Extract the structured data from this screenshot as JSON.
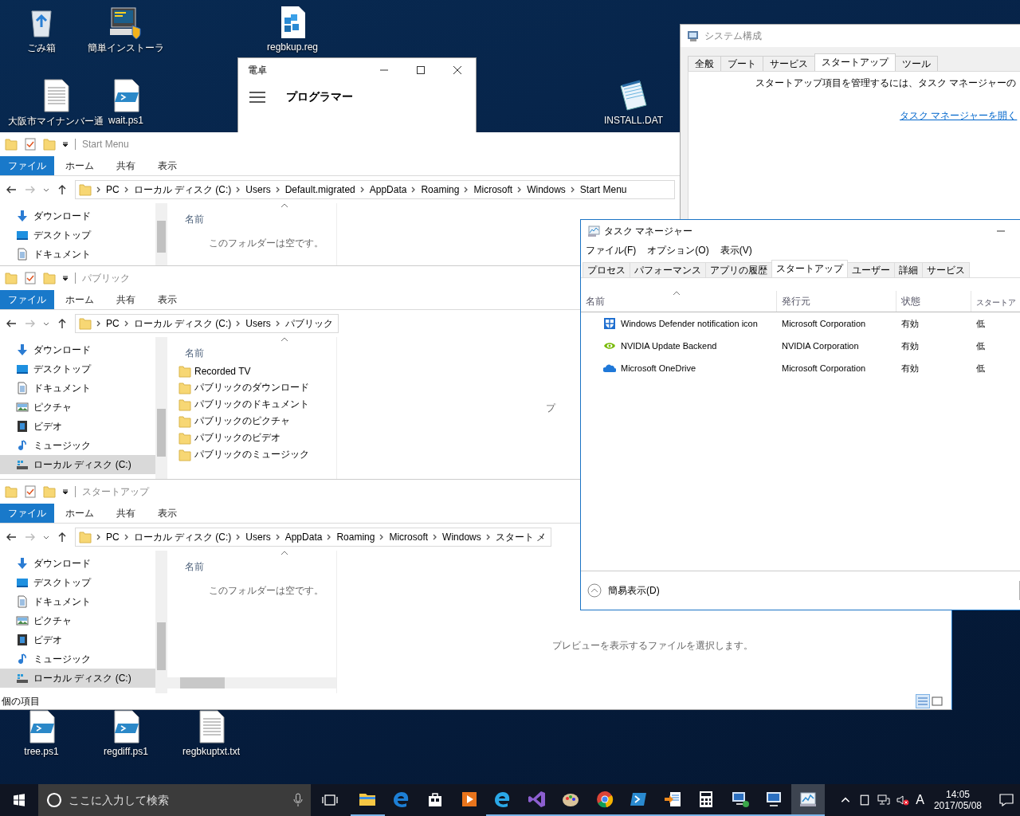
{
  "desktop_icons": [
    {
      "label": "ごみ箱",
      "kind": "recycle"
    },
    {
      "label": "簡単インストーラ",
      "kind": "installer"
    },
    {
      "label": "regbkup.reg",
      "kind": "registry"
    },
    {
      "label": "大阪市マイナンバー通",
      "kind": "text"
    },
    {
      "label": "wait.ps1",
      "kind": "script"
    },
    {
      "label": "INSTALL.DAT",
      "kind": "notepad"
    },
    {
      "label": "tree.ps1",
      "kind": "script"
    },
    {
      "label": "regdiff.ps1",
      "kind": "script"
    },
    {
      "label": "regbkuptxt.txt",
      "kind": "text"
    }
  ],
  "calculator": {
    "title": "電卓",
    "mode": "プログラマー"
  },
  "system_config": {
    "title": "システム構成",
    "tabs": [
      {
        "label": "全般",
        "selected": false
      },
      {
        "label": "ブート",
        "selected": false
      },
      {
        "label": "サービス",
        "selected": false
      },
      {
        "label": "スタートアップ",
        "selected": true
      },
      {
        "label": "ツール",
        "selected": false
      }
    ],
    "message": "スタートアップ項目を管理するには、タスク マネージャーの",
    "link": "タスク マネージャーを開く"
  },
  "explorers": [
    {
      "title": "Start Menu",
      "ribbon_tabs": [
        {
          "label": "ファイル",
          "selected": true
        },
        {
          "label": "ホーム",
          "selected": false
        },
        {
          "label": "共有",
          "selected": false
        },
        {
          "label": "表示",
          "selected": false
        }
      ],
      "path": [
        "PC",
        "ローカル ディスク (C:)",
        "Users",
        "Default.migrated",
        "AppData",
        "Roaming",
        "Microsoft",
        "Windows",
        "Start Menu"
      ],
      "nav": [
        {
          "label": "ダウンロード",
          "kind": "download",
          "selected": false
        },
        {
          "label": "デスクトップ",
          "kind": "desktop",
          "selected": false
        },
        {
          "label": "ドキュメント",
          "kind": "documents",
          "selected": false
        }
      ],
      "column": "名前",
      "empty_text": "このフォルダーは空です。"
    },
    {
      "title": "パブリック",
      "ribbon_tabs": [
        {
          "label": "ファイル",
          "selected": true
        },
        {
          "label": "ホーム",
          "selected": false
        },
        {
          "label": "共有",
          "selected": false
        },
        {
          "label": "表示",
          "selected": false
        }
      ],
      "path": [
        "PC",
        "ローカル ディスク (C:)",
        "Users",
        "パブリック"
      ],
      "nav": [
        {
          "label": "ダウンロード",
          "kind": "download",
          "selected": false
        },
        {
          "label": "デスクトップ",
          "kind": "desktop",
          "selected": false
        },
        {
          "label": "ドキュメント",
          "kind": "documents",
          "selected": false
        },
        {
          "label": "ピクチャ",
          "kind": "pictures",
          "selected": false
        },
        {
          "label": "ビデオ",
          "kind": "videos",
          "selected": false
        },
        {
          "label": "ミュージック",
          "kind": "music",
          "selected": false
        },
        {
          "label": "ローカル ディスク (C:)",
          "kind": "drive",
          "selected": true
        }
      ],
      "column": "名前",
      "files": [
        "Recorded TV",
        "パブリックのダウンロード",
        "パブリックのドキュメント",
        "パブリックのピクチャ",
        "パブリックのビデオ",
        "パブリックのミュージック"
      ],
      "preview_text": "プ"
    },
    {
      "title": "スタートアップ",
      "ribbon_tabs": [
        {
          "label": "ファイル",
          "selected": true
        },
        {
          "label": "ホーム",
          "selected": false
        },
        {
          "label": "共有",
          "selected": false
        },
        {
          "label": "表示",
          "selected": false
        }
      ],
      "path": [
        "PC",
        "ローカル ディスク (C:)",
        "Users",
        "AppData",
        "Roaming",
        "Microsoft",
        "Windows",
        "スタート メ"
      ],
      "nav": [
        {
          "label": "ダウンロード",
          "kind": "download",
          "selected": false
        },
        {
          "label": "デスクトップ",
          "kind": "desktop",
          "selected": false
        },
        {
          "label": "ドキュメント",
          "kind": "documents",
          "selected": false
        },
        {
          "label": "ピクチャ",
          "kind": "pictures",
          "selected": false
        },
        {
          "label": "ビデオ",
          "kind": "videos",
          "selected": false
        },
        {
          "label": "ミュージック",
          "kind": "music",
          "selected": false
        },
        {
          "label": "ローカル ディスク (C:)",
          "kind": "drive",
          "selected": true
        }
      ],
      "column": "名前",
      "empty_text": "このフォルダーは空です。",
      "preview_text": "プレビューを表示するファイルを選択します。",
      "status": "個の項目"
    }
  ],
  "task_manager": {
    "title": "タスク マネージャー",
    "menu": [
      "ファイル(F)",
      "オプション(O)",
      "表示(V)"
    ],
    "tabs": [
      {
        "label": "プロセス",
        "selected": false
      },
      {
        "label": "パフォーマンス",
        "selected": false
      },
      {
        "label": "アプリの履歴",
        "selected": false
      },
      {
        "label": "スタートアップ",
        "selected": true
      },
      {
        "label": "ユーザー",
        "selected": false
      },
      {
        "label": "詳細",
        "selected": false
      },
      {
        "label": "サービス",
        "selected": false
      }
    ],
    "columns": [
      "名前",
      "発行元",
      "状態",
      "スタートア"
    ],
    "rows": [
      {
        "kind": "shield",
        "name": "Windows Defender notification icon",
        "publisher": "Microsoft Corporation",
        "status": "有効",
        "impact": "低"
      },
      {
        "kind": "eye",
        "name": "NVIDIA Update Backend",
        "publisher": "NVIDIA Corporation",
        "status": "有効",
        "impact": "低"
      },
      {
        "kind": "cloud",
        "name": "Microsoft OneDrive",
        "publisher": "Microsoft Corporation",
        "status": "有効",
        "impact": "低"
      }
    ],
    "footer": "簡易表示(D)"
  },
  "taskbar": {
    "search_placeholder": "ここに入力して検索",
    "apps": [
      {
        "kind": "folder",
        "running": true,
        "active": false
      },
      {
        "kind": "edge",
        "running": false,
        "active": false
      },
      {
        "kind": "store",
        "running": false,
        "active": false
      },
      {
        "kind": "media",
        "running": false,
        "active": false
      },
      {
        "kind": "ie",
        "running": true,
        "active": false
      },
      {
        "kind": "vs",
        "running": true,
        "active": false
      },
      {
        "kind": "paint",
        "running": true,
        "active": false
      },
      {
        "kind": "chrome",
        "running": true,
        "active": false
      },
      {
        "kind": "terminal",
        "running": true,
        "active": false
      },
      {
        "kind": "transfer",
        "running": true,
        "active": false
      },
      {
        "kind": "calculator",
        "running": true,
        "active": false
      },
      {
        "kind": "remote",
        "running": true,
        "active": false
      },
      {
        "kind": "monitor",
        "running": true,
        "active": false
      },
      {
        "kind": "taskmgr",
        "running": true,
        "active": true
      }
    ],
    "ime": "A",
    "time": "14:05",
    "date": "2017/05/08"
  }
}
